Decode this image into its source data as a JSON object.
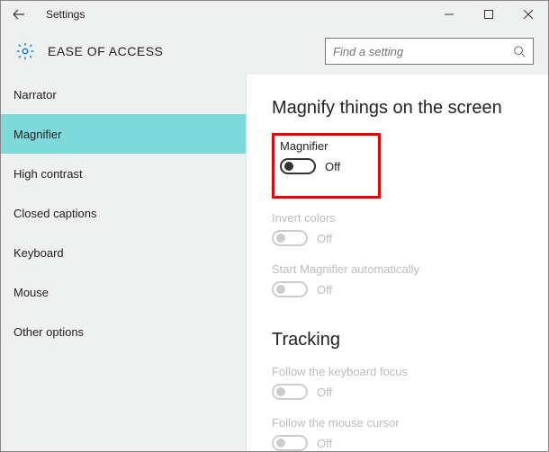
{
  "titlebar": {
    "title": "Settings"
  },
  "header": {
    "title": "EASE OF ACCESS",
    "search_placeholder": "Find a setting"
  },
  "sidebar": {
    "items": [
      {
        "label": "Narrator"
      },
      {
        "label": "Magnifier"
      },
      {
        "label": "High contrast"
      },
      {
        "label": "Closed captions"
      },
      {
        "label": "Keyboard"
      },
      {
        "label": "Mouse"
      },
      {
        "label": "Other options"
      }
    ],
    "selected_index": 1
  },
  "content": {
    "section1_title": "Magnify things on the screen",
    "magnifier": {
      "label": "Magnifier",
      "state": "Off"
    },
    "invert": {
      "label": "Invert colors",
      "state": "Off"
    },
    "autostart": {
      "label": "Start Magnifier automatically",
      "state": "Off"
    },
    "section2_title": "Tracking",
    "follow_keyboard": {
      "label": "Follow the keyboard focus",
      "state": "Off"
    },
    "follow_mouse": {
      "label": "Follow the mouse cursor",
      "state": "Off"
    }
  }
}
